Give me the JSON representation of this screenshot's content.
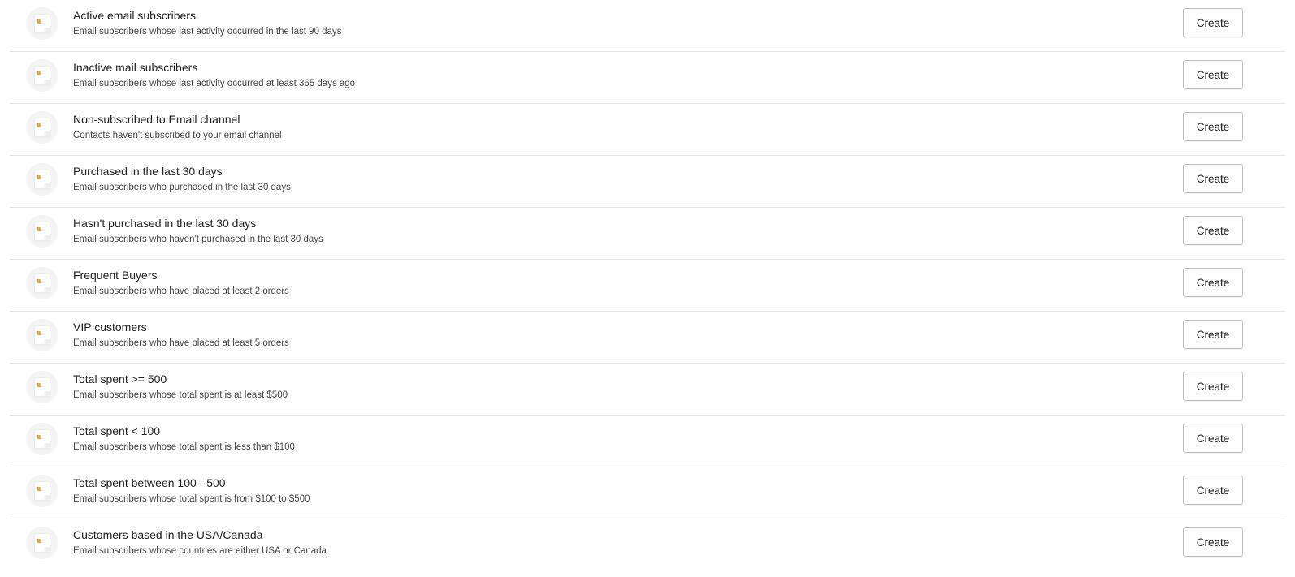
{
  "segments": [
    {
      "title": "Active email subscribers",
      "description": "Email subscribers whose last activity occurred in the last 90 days",
      "button": "Create"
    },
    {
      "title": "Inactive mail subscribers",
      "description": "Email subscribers whose last activity occurred at least 365 days ago",
      "button": "Create"
    },
    {
      "title": "Non-subscribed to Email channel",
      "description": "Contacts haven't subscribed to your email channel",
      "button": "Create"
    },
    {
      "title": "Purchased in the last 30 days",
      "description": "Email subscribers who purchased in the last 30 days",
      "button": "Create"
    },
    {
      "title": "Hasn't purchased in the last 30 days",
      "description": "Email subscribers who haven't purchased in the last 30 days",
      "button": "Create"
    },
    {
      "title": "Frequent Buyers",
      "description": "Email subscribers who have placed at least 2 orders",
      "button": "Create"
    },
    {
      "title": "VIP customers",
      "description": "Email subscribers who have placed at least 5 orders",
      "button": "Create"
    },
    {
      "title": "Total spent >= 500",
      "description": "Email subscribers whose total spent is at least $500",
      "button": "Create"
    },
    {
      "title": "Total spent < 100",
      "description": "Email subscribers whose total spent is less than $100",
      "button": "Create"
    },
    {
      "title": "Total spent between 100 - 500",
      "description": "Email subscribers whose total spent is from $100 to $500",
      "button": "Create"
    },
    {
      "title": "Customers based in the USA/Canada",
      "description": "Email subscribers whose countries are either USA or Canada",
      "button": "Create"
    }
  ],
  "icon": "document-icon",
  "colors": {
    "icon_accent": "#e3a94f",
    "divider": "#e4e5e7",
    "button_border": "#babfc3"
  }
}
